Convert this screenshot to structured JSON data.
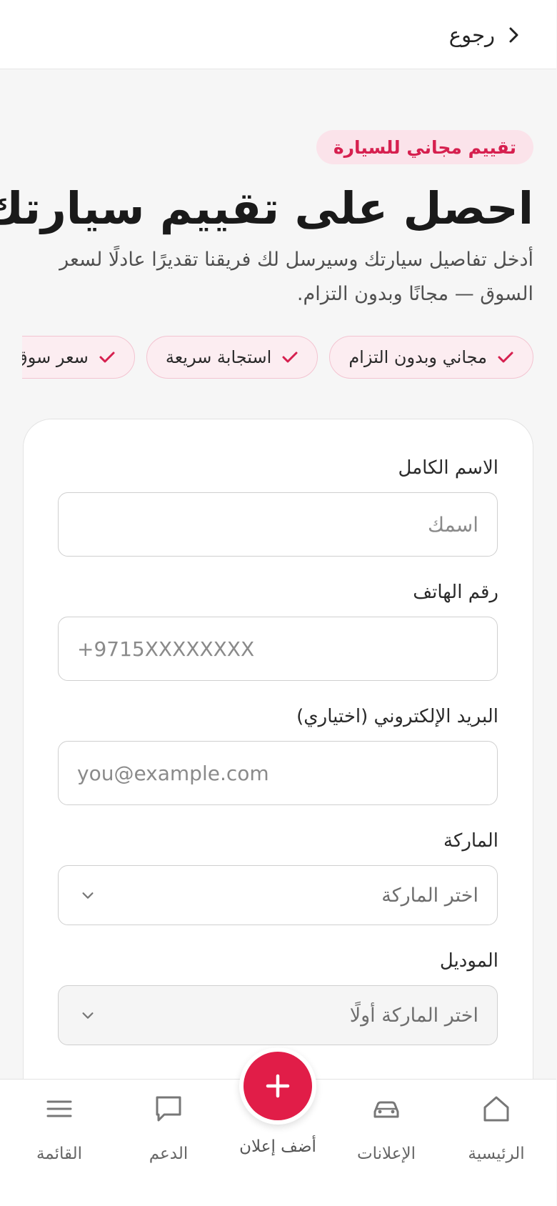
{
  "header": {
    "back_label": "رجوع"
  },
  "hero": {
    "badge": "تقييم مجاني للسيارة",
    "title": "احصل على تقييم سيارتك",
    "subtitle": "أدخل تفاصيل سيارتك وسيرسل لك فريقنا تقديرًا عادلًا لسعر السوق — مجانًا وبدون التزام."
  },
  "chips": [
    {
      "label": "مجاني وبدون التزام",
      "icon": "check-icon"
    },
    {
      "label": "استجابة سريعة",
      "icon": "check-icon"
    },
    {
      "label": "سعر سوق",
      "icon": "check-icon"
    }
  ],
  "form": {
    "full_name": {
      "label": "الاسم الكامل",
      "placeholder": "اسمك",
      "value": ""
    },
    "phone": {
      "label": "رقم الهاتف",
      "placeholder": "+9715XXXXXXXX",
      "value": ""
    },
    "email": {
      "label": "البريد الإلكتروني (اختياري)",
      "placeholder": "you@example.com",
      "value": ""
    },
    "make": {
      "label": "الماركة",
      "selected": "اختر الماركة"
    },
    "model": {
      "label": "الموديل",
      "selected": "اختر الماركة أولًا"
    }
  },
  "bottom_nav": {
    "home": {
      "label": "الرئيسية",
      "icon": "home-icon"
    },
    "listings": {
      "label": "الإعلانات",
      "icon": "car-icon"
    },
    "add": {
      "label": "أضف إعلان",
      "icon": "plus-icon"
    },
    "support": {
      "label": "الدعم",
      "icon": "chat-icon"
    },
    "menu": {
      "label": "القائمة",
      "icon": "menu-icon"
    }
  },
  "colors": {
    "accent": "#e11d48",
    "badge_bg": "#fbe3ea",
    "badge_text": "#d6204f",
    "chip_bg": "#fcedf1",
    "page_bg": "#f6f6f6"
  }
}
